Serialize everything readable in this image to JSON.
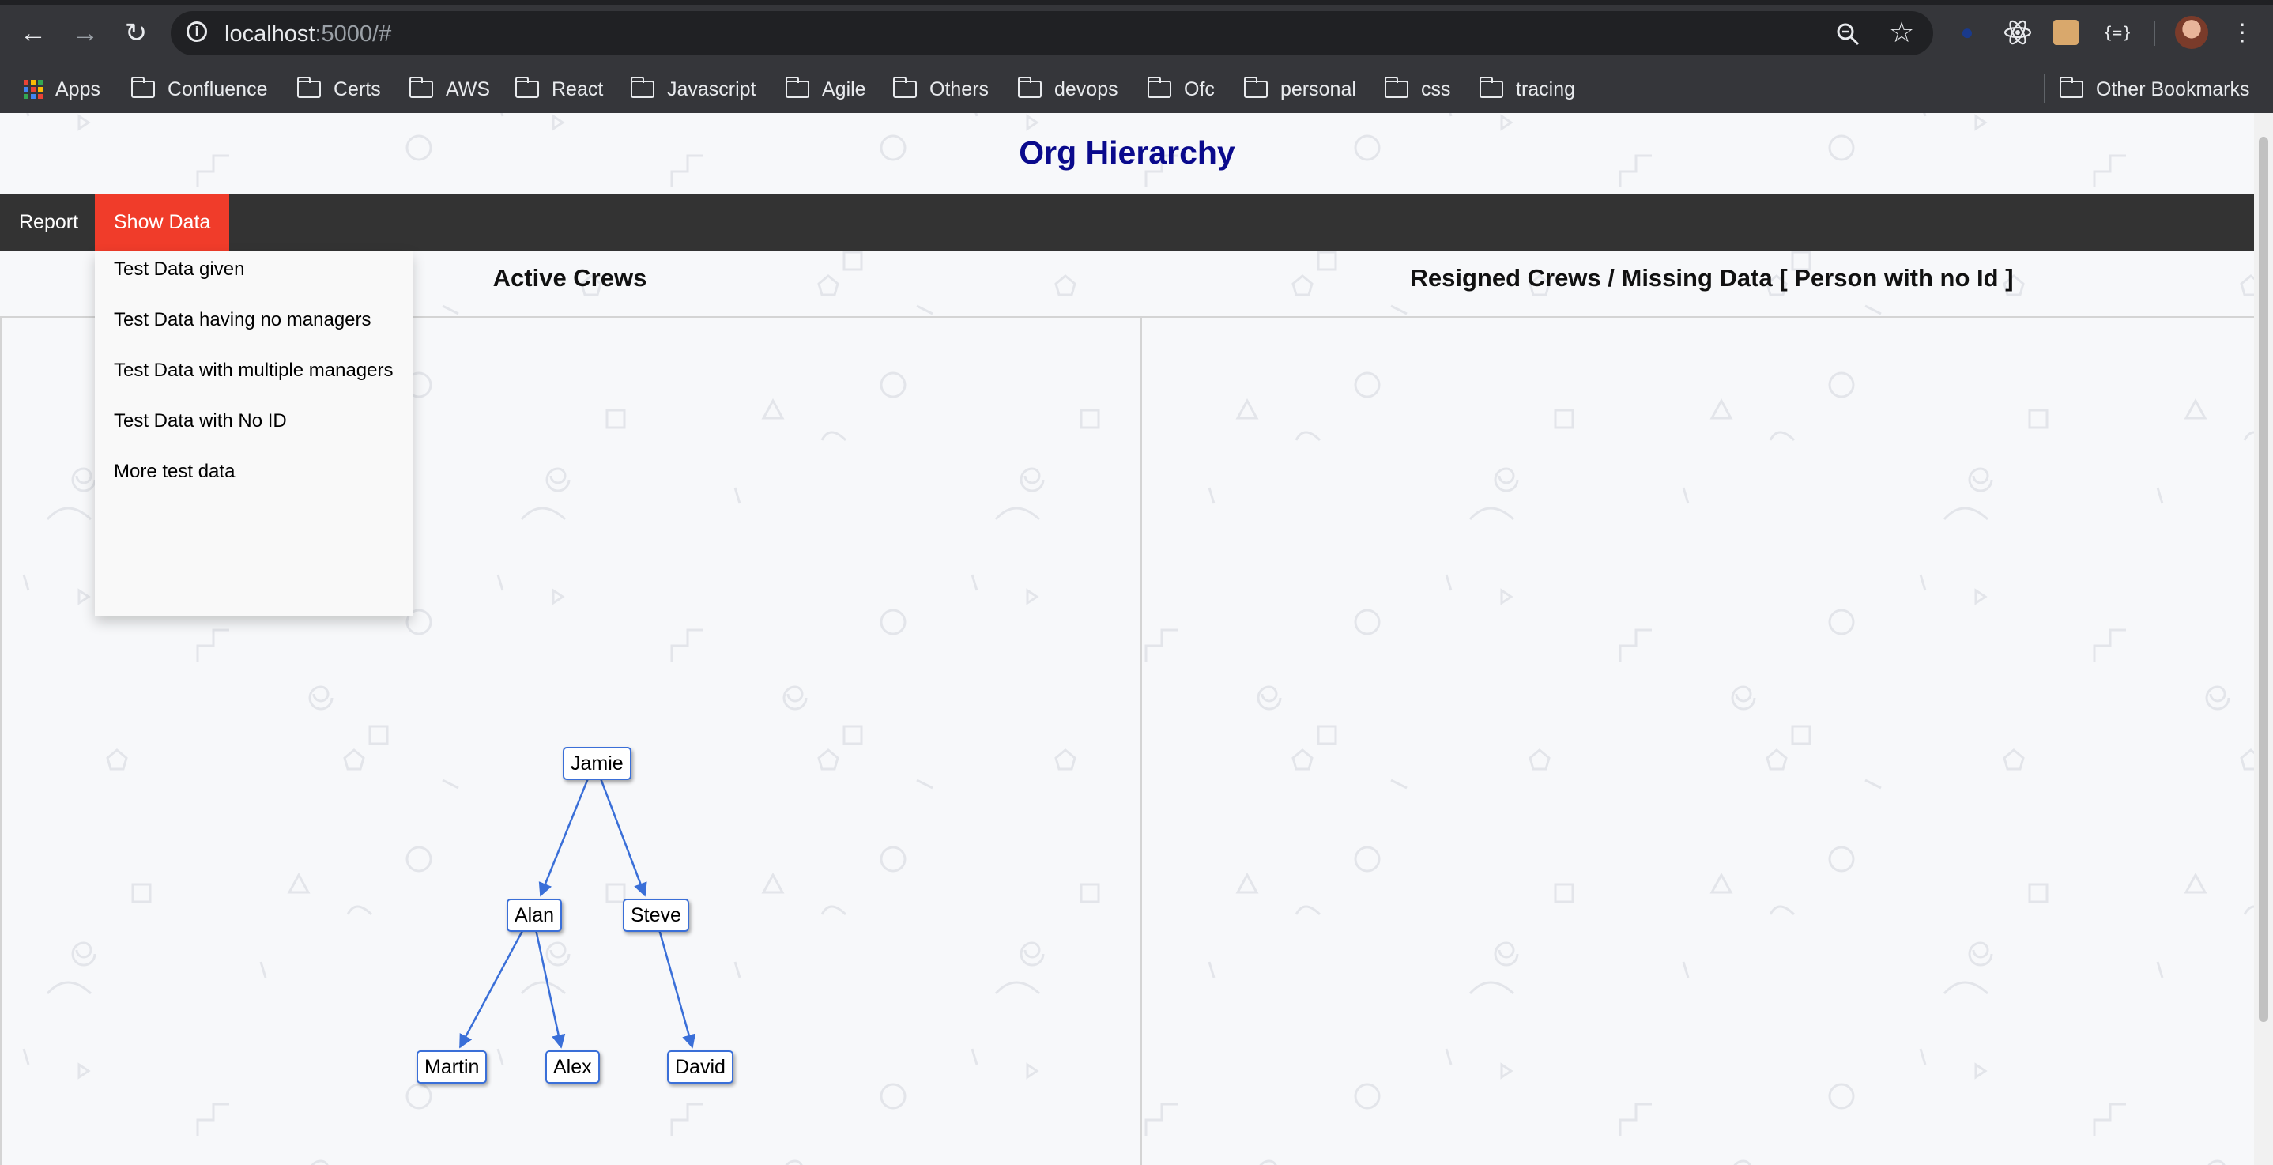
{
  "browser": {
    "url_host": "localhost",
    "url_rest": ":5000/#",
    "bookmarks": [
      "Apps",
      "Confluence",
      "Certs",
      "AWS",
      "React",
      "Javascript",
      "Agile",
      "Others",
      "devops",
      "Ofc",
      "personal",
      "css",
      "tracing"
    ],
    "other_bookmarks": "Other Bookmarks",
    "icons": [
      "back-arrow-icon",
      "forward-arrow-icon",
      "reload-icon",
      "info-icon",
      "zoom-icon",
      "star-icon",
      "react-devtools-icon",
      "extension-icon",
      "json-viewer-icon",
      "avatar",
      "menu-kebab-icon"
    ]
  },
  "page": {
    "title": "Org Hierarchy",
    "menu": {
      "report": "Report",
      "show_data": "Show Data"
    },
    "dropdown": [
      "Test Data given",
      "Test Data having no managers",
      "Test Data with multiple managers",
      "Test Data with No ID",
      "More test data"
    ],
    "active_heading": "Active Crews",
    "resigned_heading": "Resigned Crews / Missing Data [ Person with no Id ]",
    "tree": {
      "root": "Jamie",
      "level1": [
        "Alan",
        "Steve"
      ],
      "level2": [
        "Martin",
        "Alex",
        "David"
      ]
    }
  },
  "colors": {
    "title": "#0a0a8c",
    "menubar": "#333333",
    "active_menu": "#f03c2a",
    "edge": "#3a6fd8"
  }
}
